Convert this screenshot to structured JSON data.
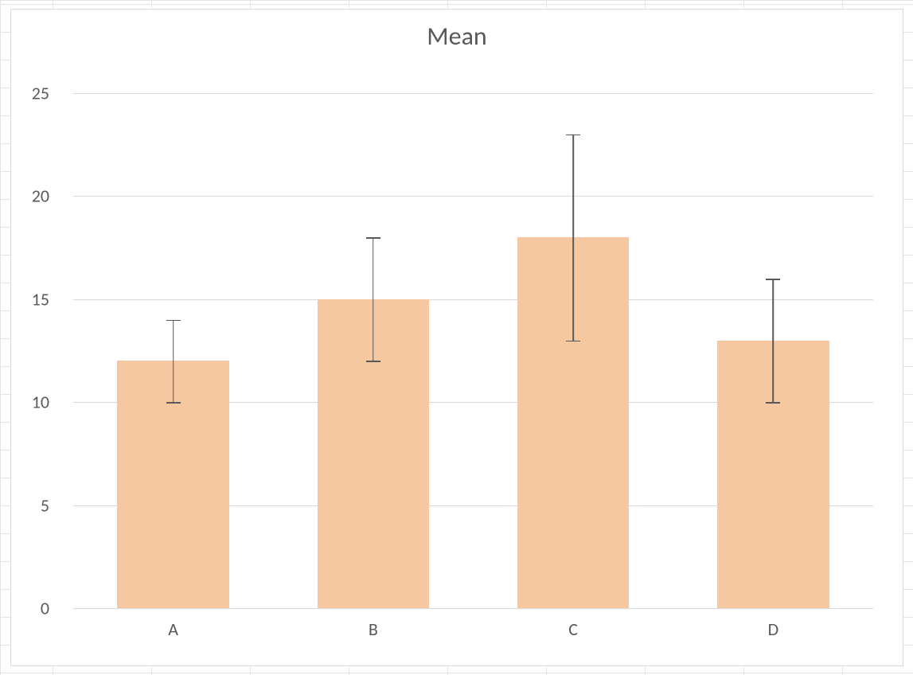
{
  "chart_data": {
    "type": "bar",
    "title": "Mean",
    "categories": [
      "A",
      "B",
      "C",
      "D"
    ],
    "values": [
      12,
      15,
      18,
      13
    ],
    "error_plus": [
      2,
      3,
      5,
      3
    ],
    "error_minus": [
      2,
      3,
      5,
      3
    ],
    "xlabel": "",
    "ylabel": "",
    "ylim": [
      0,
      25
    ],
    "y_ticks": [
      0,
      5,
      10,
      15,
      20,
      25
    ],
    "bar_color": "#f6c8a2",
    "grid": true
  },
  "spreadsheet": {
    "col_grid_positions": [
      0,
      66,
      190,
      314,
      438,
      562,
      686,
      810,
      934,
      1058,
      1147
    ],
    "row_grid_positions": [
      0,
      5,
      40,
      75,
      110,
      145,
      180,
      215,
      250,
      285,
      320,
      355,
      390,
      425,
      460,
      495,
      530,
      565,
      600,
      635,
      670,
      705,
      740,
      775,
      810,
      845
    ]
  }
}
